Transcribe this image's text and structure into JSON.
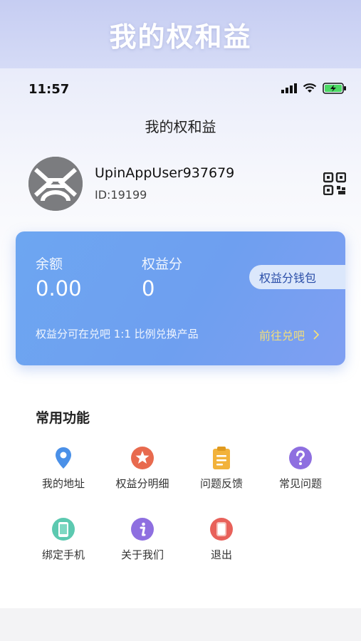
{
  "banner": {
    "title": "我的权和益"
  },
  "status_bar": {
    "time": "11:57"
  },
  "nav": {
    "title": "我的权和益"
  },
  "profile": {
    "username": "UpinAppUser937679",
    "id": "ID:19199"
  },
  "card": {
    "balance_label": "余额",
    "balance_value": "0.00",
    "points_label": "权益分",
    "points_value": "0",
    "wallet_button": "权益分钱包",
    "note": "权益分可在兑吧 1:1 比例兑换产品",
    "goto_link": "前往兑吧"
  },
  "functions": {
    "title": "常用功能",
    "items": [
      {
        "label": "我的地址",
        "icon": "location-pin-icon",
        "color": "#4a90e8"
      },
      {
        "label": "权益分明细",
        "icon": "star-badge-icon",
        "color": "#e86a4e"
      },
      {
        "label": "问题反馈",
        "icon": "clipboard-icon",
        "color": "#f2b23a"
      },
      {
        "label": "常见问题",
        "icon": "question-icon",
        "color": "#8e6fe0"
      },
      {
        "label": "绑定手机",
        "icon": "phone-icon",
        "color": "#5cc9b0"
      },
      {
        "label": "关于我们",
        "icon": "info-icon",
        "color": "#8e6fe0"
      },
      {
        "label": "退出",
        "icon": "logout-icon",
        "color": "#e8615a"
      }
    ]
  },
  "colors": {
    "card_start": "#6da6f1",
    "card_end": "#7f9ff2",
    "goto_link": "#f3de7a",
    "wallet_text": "#2a4ea8"
  }
}
